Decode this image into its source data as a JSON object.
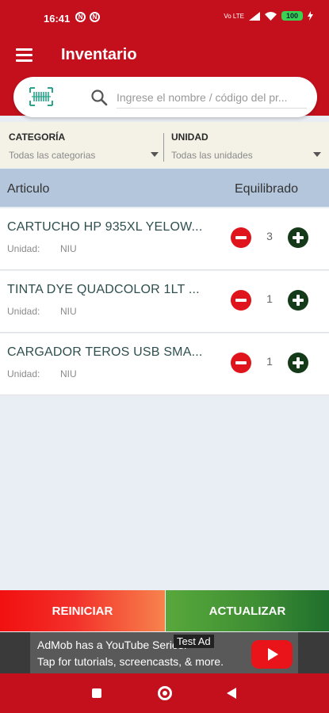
{
  "status_bar": {
    "time": "16:41",
    "notif_icons": [
      "N",
      "N"
    ],
    "battery": "100",
    "network": "Vo LTE"
  },
  "app_bar": {
    "title": "Inventario"
  },
  "search": {
    "placeholder": "Ingrese el nombre / código del pr...",
    "value": ""
  },
  "filters": {
    "category": {
      "label": "CATEGORÍA",
      "value": "Todas las categorias"
    },
    "unit": {
      "label": "UNIDAD",
      "value": "Todas las unidades"
    }
  },
  "table": {
    "columns": [
      "Articulo",
      "Equilibrado"
    ],
    "rows": [
      {
        "name": "CARTUCHO HP 935XL YELOW...",
        "unit_label": "Unidad:",
        "unit": "NIU",
        "qty": "3"
      },
      {
        "name": "TINTA DYE QUADCOLOR 1LT ...",
        "unit_label": "Unidad:",
        "unit": "NIU",
        "qty": "1"
      },
      {
        "name": "CARGADOR TEROS USB SMA...",
        "unit_label": "Unidad:",
        "unit": "NIU",
        "qty": "1"
      }
    ]
  },
  "actions": {
    "reset": "REINICIAR",
    "update": "ACTUALIZAR"
  },
  "ad": {
    "tag": "Test Ad",
    "line1": "AdMob has a YouTube Series!",
    "line2": "Tap for tutorials, screencasts, & more."
  },
  "colors": {
    "primary": "#c4101d",
    "minus": "#e0141c",
    "plus": "#153a19",
    "header": "#b3c6dc",
    "filter_bg": "#f4f1e6"
  }
}
